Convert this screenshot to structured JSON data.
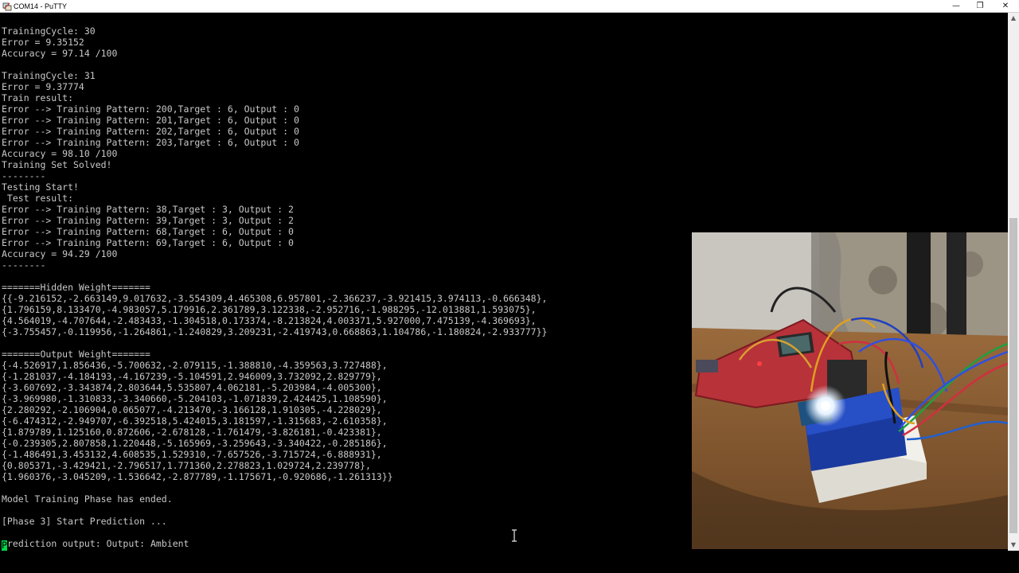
{
  "window": {
    "title": "COM14 - PuTTY",
    "minimize_glyph": "—",
    "maximize_glyph": "❐",
    "close_glyph": "✕"
  },
  "terminal": {
    "lines": [
      "",
      "TrainingCycle: 30",
      "Error = 9.35152",
      "Accuracy = 97.14 /100",
      "",
      "TrainingCycle: 31",
      "Error = 9.37774",
      "Train result:",
      "Error --> Training Pattern: 200,Target : 6, Output : 0",
      "Error --> Training Pattern: 201,Target : 6, Output : 0",
      "Error --> Training Pattern: 202,Target : 6, Output : 0",
      "Error --> Training Pattern: 203,Target : 6, Output : 0",
      "Accuracy = 98.10 /100",
      "Training Set Solved!",
      "--------",
      "Testing Start!",
      " Test result:",
      "Error --> Training Pattern: 38,Target : 3, Output : 2",
      "Error --> Training Pattern: 39,Target : 3, Output : 2",
      "Error --> Training Pattern: 68,Target : 6, Output : 0",
      "Error --> Training Pattern: 69,Target : 6, Output : 0",
      "Accuracy = 94.29 /100",
      "--------",
      "",
      "=======Hidden Weight=======",
      "{{-9.216152,-2.663149,9.017632,-3.554309,4.465308,6.957801,-2.366237,-3.921415,3.974113,-0.666348},",
      "{1.796159,8.133470,-4.983057,5.179916,2.361789,3.122338,-2.952716,-1.988295,-12.013881,1.593075},",
      "{4.564019,-4.707644,-2.483433,-1.304518,0.173374,-8.213824,4.003371,5.927000,7.475139,-4.369693},",
      "{-3.755457,-0.119956,-1.264861,-1.240829,3.209231,-2.419743,0.668863,1.104786,-1.180824,-2.933777}}",
      "",
      "=======Output Weight=======",
      "{-4.526917,1.856436,-5.700632,-2.079115,-1.388810,-4.359563,3.727488},",
      "{-1.281037,-4.184193,-4.167239,-5.104591,2.946009,3.732092,2.829779},",
      "{-3.607692,-3.343874,2.803644,5.535807,4.062181,-5.203984,-4.005300},",
      "{-3.969980,-1.310833,-3.340660,-5.204103,-1.071839,2.424425,1.108590},",
      "{2.280292,-2.106904,0.065077,-4.213470,-3.166128,1.910305,-4.228029},",
      "{-6.474312,-2.949707,-6.392518,5.424015,3.181597,-1.315683,-2.610358},",
      "{1.879789,1.125160,0.872606,-2.678128,-1.761479,-3.826181,-0.423381},",
      "{-0.239305,2.807858,1.220448,-5.165969,-3.259643,-3.340422,-0.285186},",
      "{-1.486491,3.453132,4.608535,1.529310,-7.657526,-3.715724,-6.888931},",
      "{0.805371,-3.429421,-2.796517,1.771360,2.278823,1.029724,2.239778},",
      "{1.960376,-3.045209,-1.536642,-2.877789,-1.175671,-0.920686,-1.261313}}",
      "",
      "Model Training Phase has ended.",
      "",
      "[Phase 3] Start Prediction ...",
      ""
    ],
    "prompt_line_rest": "rediction output: Output: Ambient",
    "prompt_line_first_char": "P"
  },
  "colors": {
    "terminal_bg": "#000000",
    "terminal_fg": "#c8c8c8",
    "cursor": "#00d84a"
  }
}
